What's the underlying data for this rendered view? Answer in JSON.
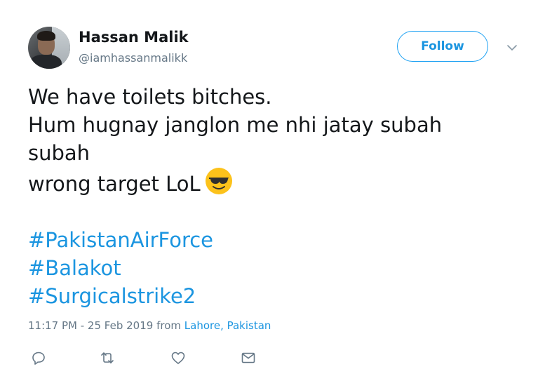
{
  "user": {
    "display_name": "Hassan Malik",
    "handle": "@iamhassanmalikk"
  },
  "follow_label": "Follow",
  "tweet": {
    "lines": [
      "We have toilets bitches.",
      "Hum hugnay janglon me nhi jatay subah",
      "subah",
      "wrong target LoL"
    ],
    "emoji": "smiling-face-with-sunglasses-icon",
    "hashtags": [
      "#PakistanAirForce",
      "#Balakot",
      "#Surgicalstrike2"
    ]
  },
  "meta": {
    "timestamp": "11:17 PM - 25 Feb 2019",
    "from_word": "from",
    "location": "Lahore, Pakistan"
  },
  "actions": [
    "reply-icon",
    "retweet-icon",
    "like-icon",
    "direct-message-icon"
  ],
  "colors": {
    "accent": "#1b95e0",
    "text": "#14171a",
    "secondary": "#657786",
    "icon": "#657786"
  }
}
